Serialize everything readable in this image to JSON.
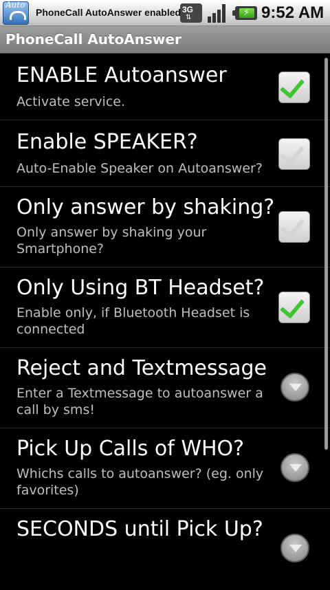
{
  "status_bar": {
    "app_icon_label": "Auto",
    "notification": "PhoneCall AutoAnswer enabled",
    "network": "3G",
    "time": "9:52 AM"
  },
  "app": {
    "title": "PhoneCall AutoAnswer"
  },
  "preferences": [
    {
      "title": "ENABLE Autoanswer",
      "summary": "Activate service.",
      "control": "checkbox",
      "checked": true
    },
    {
      "title": "Enable SPEAKER?",
      "summary": "Auto-Enable Speaker on Autoanswer?",
      "control": "checkbox",
      "checked": false
    },
    {
      "title": "Only answer by shaking?",
      "summary": "Only answer by shaking your Smartphone?",
      "control": "checkbox",
      "checked": false
    },
    {
      "title": "Only Using BT Headset?",
      "summary": "Enable only, if Bluetooth Headset is connected",
      "control": "checkbox",
      "checked": true
    },
    {
      "title": "Reject and Textmessage",
      "summary": "Enter a Textmessage to autoanswer a call by sms!",
      "control": "dropdown"
    },
    {
      "title": "Pick Up Calls of WHO?",
      "summary": "Whichs calls to autoanswer? (eg. only favorites)",
      "control": "dropdown"
    },
    {
      "title": "SECONDS until Pick Up?",
      "summary": "",
      "control": "dropdown"
    }
  ]
}
